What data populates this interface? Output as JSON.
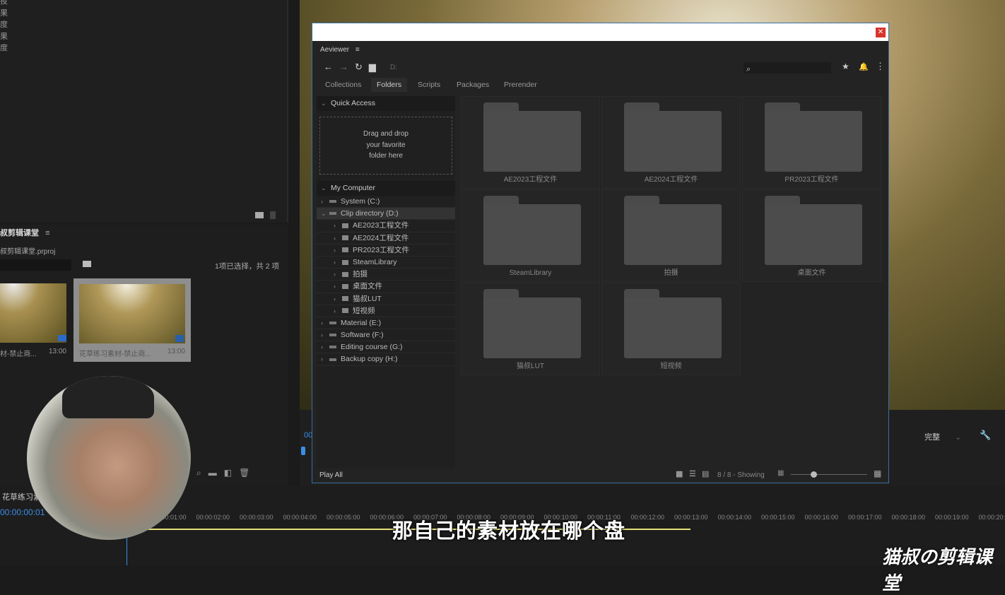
{
  "left_panel": {
    "effects_fragments": [
      "投",
      "果",
      "度",
      "果",
      "度"
    ]
  },
  "project": {
    "title": "叔剪辑课堂",
    "file": "叔剪辑课堂.prproj",
    "selection": "1项已选择，共 2 项",
    "clips": [
      {
        "name": "材-禁止商...",
        "duration": "13:00"
      },
      {
        "name": "花草练习素材-禁止商...",
        "duration": "13:00"
      }
    ]
  },
  "aeviewer": {
    "title": "Aeviewer",
    "path": "D:",
    "tabs": [
      "Collections",
      "Folders",
      "Scripts",
      "Packages",
      "Prerender"
    ],
    "active_tab": "Folders",
    "quick_access": {
      "heading": "Quick Access",
      "drop_text": [
        "Drag and drop",
        "your favorite",
        "folder here"
      ]
    },
    "my_computer": {
      "heading": "My Computer",
      "drives": [
        {
          "label": "System (C:)",
          "expanded": false
        },
        {
          "label": "Clip directory (D:)",
          "expanded": true,
          "children": [
            "AE2023工程文件",
            "AE2024工程文件",
            "PR2023工程文件",
            "SteamLibrary",
            "拍摄",
            "桌面文件",
            "猫叔LUT",
            "短视频"
          ]
        },
        {
          "label": "Material (E:)",
          "expanded": false
        },
        {
          "label": "Software (F:)",
          "expanded": false
        },
        {
          "label": "Editing course (G:)",
          "expanded": false
        },
        {
          "label": "Backup copy (H:)",
          "expanded": false
        }
      ]
    },
    "folders": [
      "AE2023工程文件",
      "AE2024工程文件",
      "PR2023工程文件",
      "SteamLibrary",
      "拍摄",
      "桌面文件",
      "猫叔LUT",
      "短视频"
    ],
    "footer": {
      "play_all": "Play All",
      "count": "8 / 8 - Showing"
    }
  },
  "program": {
    "quality": "完整",
    "timecode_partial": "00"
  },
  "timeline": {
    "sequence": "花草练习素",
    "timecode": "00:00:00:01",
    "ticks": [
      "00:00:01:00",
      "00:00:02:00",
      "00:00:03:00",
      "00:00:04:00",
      "00:00:05:00",
      "00:00:06:00",
      "00:00:07:00",
      "00:00:08:00",
      "00:00:09:00",
      "00:00:10:00",
      "00:00:11:00",
      "00:00:12:00",
      "00:00:13:00",
      "00:00:14:00",
      "00:00:15:00",
      "00:00:16:00",
      "00:00:17:00",
      "00:00:18:00",
      "00:00:19:00",
      "00:00:20:00"
    ]
  },
  "subtitle": "那自己的素材放在哪个盘",
  "watermark": "猫叔の剪辑课堂",
  "colors": {
    "accent": "#3a8ee6",
    "close": "#d9342b",
    "work_area": "#e6e07a"
  }
}
